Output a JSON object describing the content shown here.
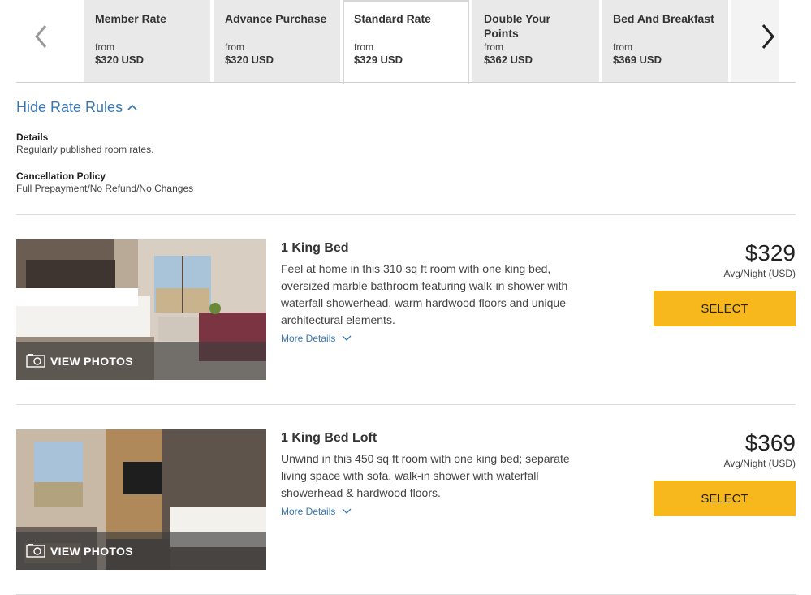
{
  "rate_tabs": [
    {
      "name": "Member Rate",
      "from_label": "from",
      "price": "$320 USD"
    },
    {
      "name": "Advance Purchase",
      "from_label": "from",
      "price": "$320 USD"
    },
    {
      "name": "Standard Rate",
      "from_label": "from",
      "price": "$329 USD",
      "active": true
    },
    {
      "name": "Double Your Points",
      "from_label": "from",
      "price": "$362 USD"
    },
    {
      "name": "Bed And Breakfast",
      "from_label": "from",
      "price": "$369 USD"
    }
  ],
  "rate_rules": {
    "toggle_label": "Hide Rate Rules",
    "details_title": "Details",
    "details_text": "Regularly published room rates.",
    "cancellation_title": "Cancellation Policy",
    "cancellation_text": "Full Prepayment/No Refund/No Changes"
  },
  "rooms": [
    {
      "title": "1 King Bed",
      "description": "Feel at home in this 310 sq ft room with one king bed, oversized marble bathroom featuring walk-in shower with waterfall showerhead, warm hardwood floors and unique architectural elements.",
      "more_details": "More Details",
      "view_photos": "VIEW PHOTOS",
      "price": "$329",
      "price_sub": "Avg/Night (USD)",
      "select_label": "SELECT"
    },
    {
      "title": "1 King Bed Loft",
      "description": "Unwind in this 450 sq ft room with one king bed; separate living space with sofa, walk-in shower with waterfall showerhead & hardwood floors.",
      "more_details": "More Details",
      "view_photos": "VIEW PHOTOS",
      "price": "$369",
      "price_sub": "Avg/Night (USD)",
      "select_label": "SELECT"
    }
  ],
  "colors": {
    "link_blue": "#3a78b5",
    "select_yellow": "#f6b81d",
    "tab_gray": "#e9e9e9"
  }
}
